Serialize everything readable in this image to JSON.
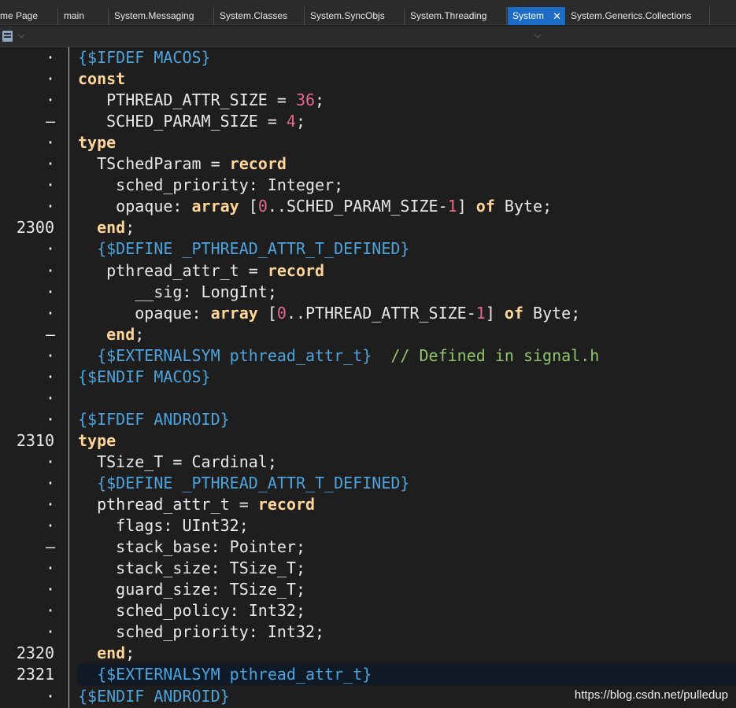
{
  "tabs": [
    {
      "label": "me Page",
      "active": false
    },
    {
      "label": "main",
      "active": false
    },
    {
      "label": "System.Messaging",
      "active": false
    },
    {
      "label": "System.Classes",
      "active": false
    },
    {
      "label": "System.SyncObjs",
      "active": false
    },
    {
      "label": "System.Threading",
      "active": false
    },
    {
      "label": "System",
      "active": true,
      "close": "✕"
    },
    {
      "label": "System.Generics.Collections",
      "active": false
    }
  ],
  "toolbar": {
    "chevron": "⌵"
  },
  "gutter": [
    "·",
    "·",
    "·",
    "–",
    "·",
    "·",
    "·",
    "·",
    "2300",
    "·",
    "·",
    "·",
    "·",
    "–",
    "·",
    "·",
    "·",
    "·",
    "2310",
    "·",
    "·",
    "·",
    "·",
    "–",
    "·",
    "·",
    "·",
    "·",
    "2320",
    "2321",
    "·"
  ],
  "code": [
    [
      [
        "dir",
        "{$IFDEF MACOS}"
      ]
    ],
    [
      [
        "kw",
        "const"
      ]
    ],
    [
      [
        "id",
        "   PTHREAD_ATTR_SIZE = "
      ],
      [
        "num",
        "36"
      ],
      [
        "id",
        ";"
      ]
    ],
    [
      [
        "id",
        "   SCHED_PARAM_SIZE = "
      ],
      [
        "num",
        "4"
      ],
      [
        "id",
        ";"
      ]
    ],
    [
      [
        "kw",
        "type"
      ]
    ],
    [
      [
        "id",
        "  TSchedParam = "
      ],
      [
        "kw",
        "record"
      ]
    ],
    [
      [
        "id",
        "    sched_priority: Integer;"
      ]
    ],
    [
      [
        "id",
        "    opaque: "
      ],
      [
        "kw",
        "array"
      ],
      [
        "id",
        " ["
      ],
      [
        "num",
        "0"
      ],
      [
        "id",
        "..SCHED_PARAM_SIZE-"
      ],
      [
        "num",
        "1"
      ],
      [
        "id",
        "] "
      ],
      [
        "kw",
        "of"
      ],
      [
        "id",
        " Byte;"
      ]
    ],
    [
      [
        "id",
        "  "
      ],
      [
        "kw",
        "end"
      ],
      [
        "id",
        ";"
      ]
    ],
    [
      [
        "dir",
        "  {$DEFINE _PTHREAD_ATTR_T_DEFINED}"
      ]
    ],
    [
      [
        "id",
        "   pthread_attr_t = "
      ],
      [
        "kw",
        "record"
      ]
    ],
    [
      [
        "id",
        "      __sig: LongInt;"
      ]
    ],
    [
      [
        "id",
        "      opaque: "
      ],
      [
        "kw",
        "array"
      ],
      [
        "id",
        " ["
      ],
      [
        "num",
        "0"
      ],
      [
        "id",
        "..PTHREAD_ATTR_SIZE-"
      ],
      [
        "num",
        "1"
      ],
      [
        "id",
        "] "
      ],
      [
        "kw",
        "of"
      ],
      [
        "id",
        " Byte;"
      ]
    ],
    [
      [
        "id",
        "   "
      ],
      [
        "kw",
        "end"
      ],
      [
        "id",
        ";"
      ]
    ],
    [
      [
        "dir",
        "  {$EXTERNALSYM pthread_attr_t}"
      ],
      [
        "id",
        "  "
      ],
      [
        "cmt",
        "// Defined in signal.h"
      ]
    ],
    [
      [
        "dir",
        "{$ENDIF MACOS}"
      ]
    ],
    [],
    [
      [
        "dir",
        "{$IFDEF ANDROID}"
      ]
    ],
    [
      [
        "kw",
        "type"
      ]
    ],
    [
      [
        "id",
        "  TSize_T = Cardinal;"
      ]
    ],
    [
      [
        "dir",
        "  {$DEFINE _PTHREAD_ATTR_T_DEFINED}"
      ]
    ],
    [
      [
        "id",
        "  pthread_attr_t = "
      ],
      [
        "kw",
        "record"
      ]
    ],
    [
      [
        "id",
        "    flags: UInt32;"
      ]
    ],
    [
      [
        "id",
        "    stack_base: Pointer;"
      ]
    ],
    [
      [
        "id",
        "    stack_size: TSize_T;"
      ]
    ],
    [
      [
        "id",
        "    guard_size: TSize_T;"
      ]
    ],
    [
      [
        "id",
        "    sched_policy: Int32;"
      ]
    ],
    [
      [
        "id",
        "    sched_priority: Int32;"
      ]
    ],
    [
      [
        "id",
        "  "
      ],
      [
        "kw",
        "end"
      ],
      [
        "id",
        ";"
      ]
    ],
    [
      [
        "dir",
        "  {$EXTERNALSYM pthread_attr_t}"
      ]
    ],
    [
      [
        "dir",
        "{$ENDIF ANDROID}"
      ]
    ]
  ],
  "watermark": "https://blog.csdn.net/pulledup"
}
